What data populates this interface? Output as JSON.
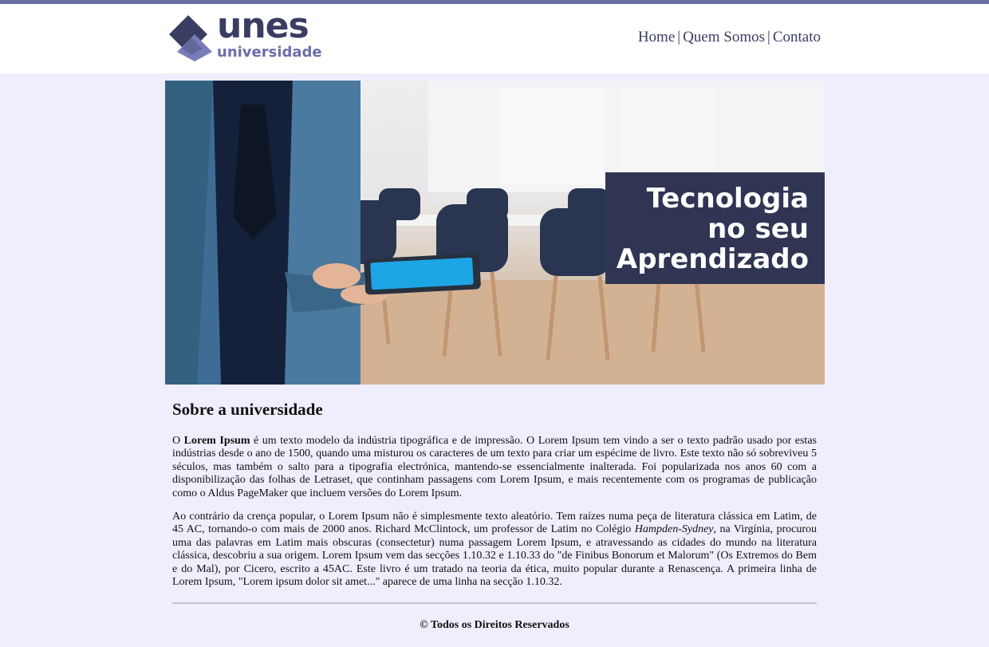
{
  "brand": {
    "name": "unes",
    "subtitle": "universidade",
    "color_primary": "#3a3d62",
    "color_secondary": "#6a6ea8"
  },
  "nav": {
    "items": [
      "Home",
      "Quem Somos",
      "Contato"
    ],
    "separator": "|"
  },
  "banner": {
    "caption_lines": [
      "Tecnologia",
      "no seu",
      "Aprendizado"
    ],
    "caption_bg": "#2f3553"
  },
  "about": {
    "title": "Sobre a universidade",
    "p1_lead": "O ",
    "p1_bold": "Lorem Ipsum",
    "p1_rest": " é um texto modelo da indústria tipográfica e de impressão. O Lorem Ipsum tem vindo a ser o texto padrão usado por estas indústrias desde o ano de 1500, quando uma misturou os caracteres de um texto para criar um espécime de livro. Este texto não só sobreviveu 5 séculos, mas também o salto para a tipografia electrónica, mantendo-se essencialmente inalterada. Foi popularizada nos anos 60 com a disponibilização das folhas de Letraset, que continham passagens com Lorem Ipsum, e mais recentemente com os programas de publicação como o Aldus PageMaker que incluem versões do Lorem Ipsum.",
    "p2_a": "Ao contrário da crença popular, o Lorem Ipsum não é simplesmente texto aleatório. Tem raízes numa peça de literatura clássica em Latim, de 45 AC, tornando-o com mais de 2000 anos. Richard McClintock, um professor de Latim no Colégio ",
    "p2_italic": "Hampden-Sydney",
    "p2_b": ", na Virgínia, procurou uma das palavras em Latim mais obscuras (consectetur) numa passagem Lorem Ipsum, e atravessando as cidades do mundo na literatura clássica, descobriu a sua origem. Lorem Ipsum vem das secções 1.10.32 e 1.10.33 do \"de Finibus Bonorum et Malorum\" (Os Extremos do Bem e do Mal), por Cicero, escrito a 45AC. Este livro é um tratado na teoria da ética, muito popular durante a Renascença. A primeira linha de Lorem Ipsum, \"Lorem ipsum dolor sit amet...\" aparece de uma linha na secção 1.10.32."
  },
  "footer": {
    "text": "© Todos os Direitos Reservados"
  }
}
